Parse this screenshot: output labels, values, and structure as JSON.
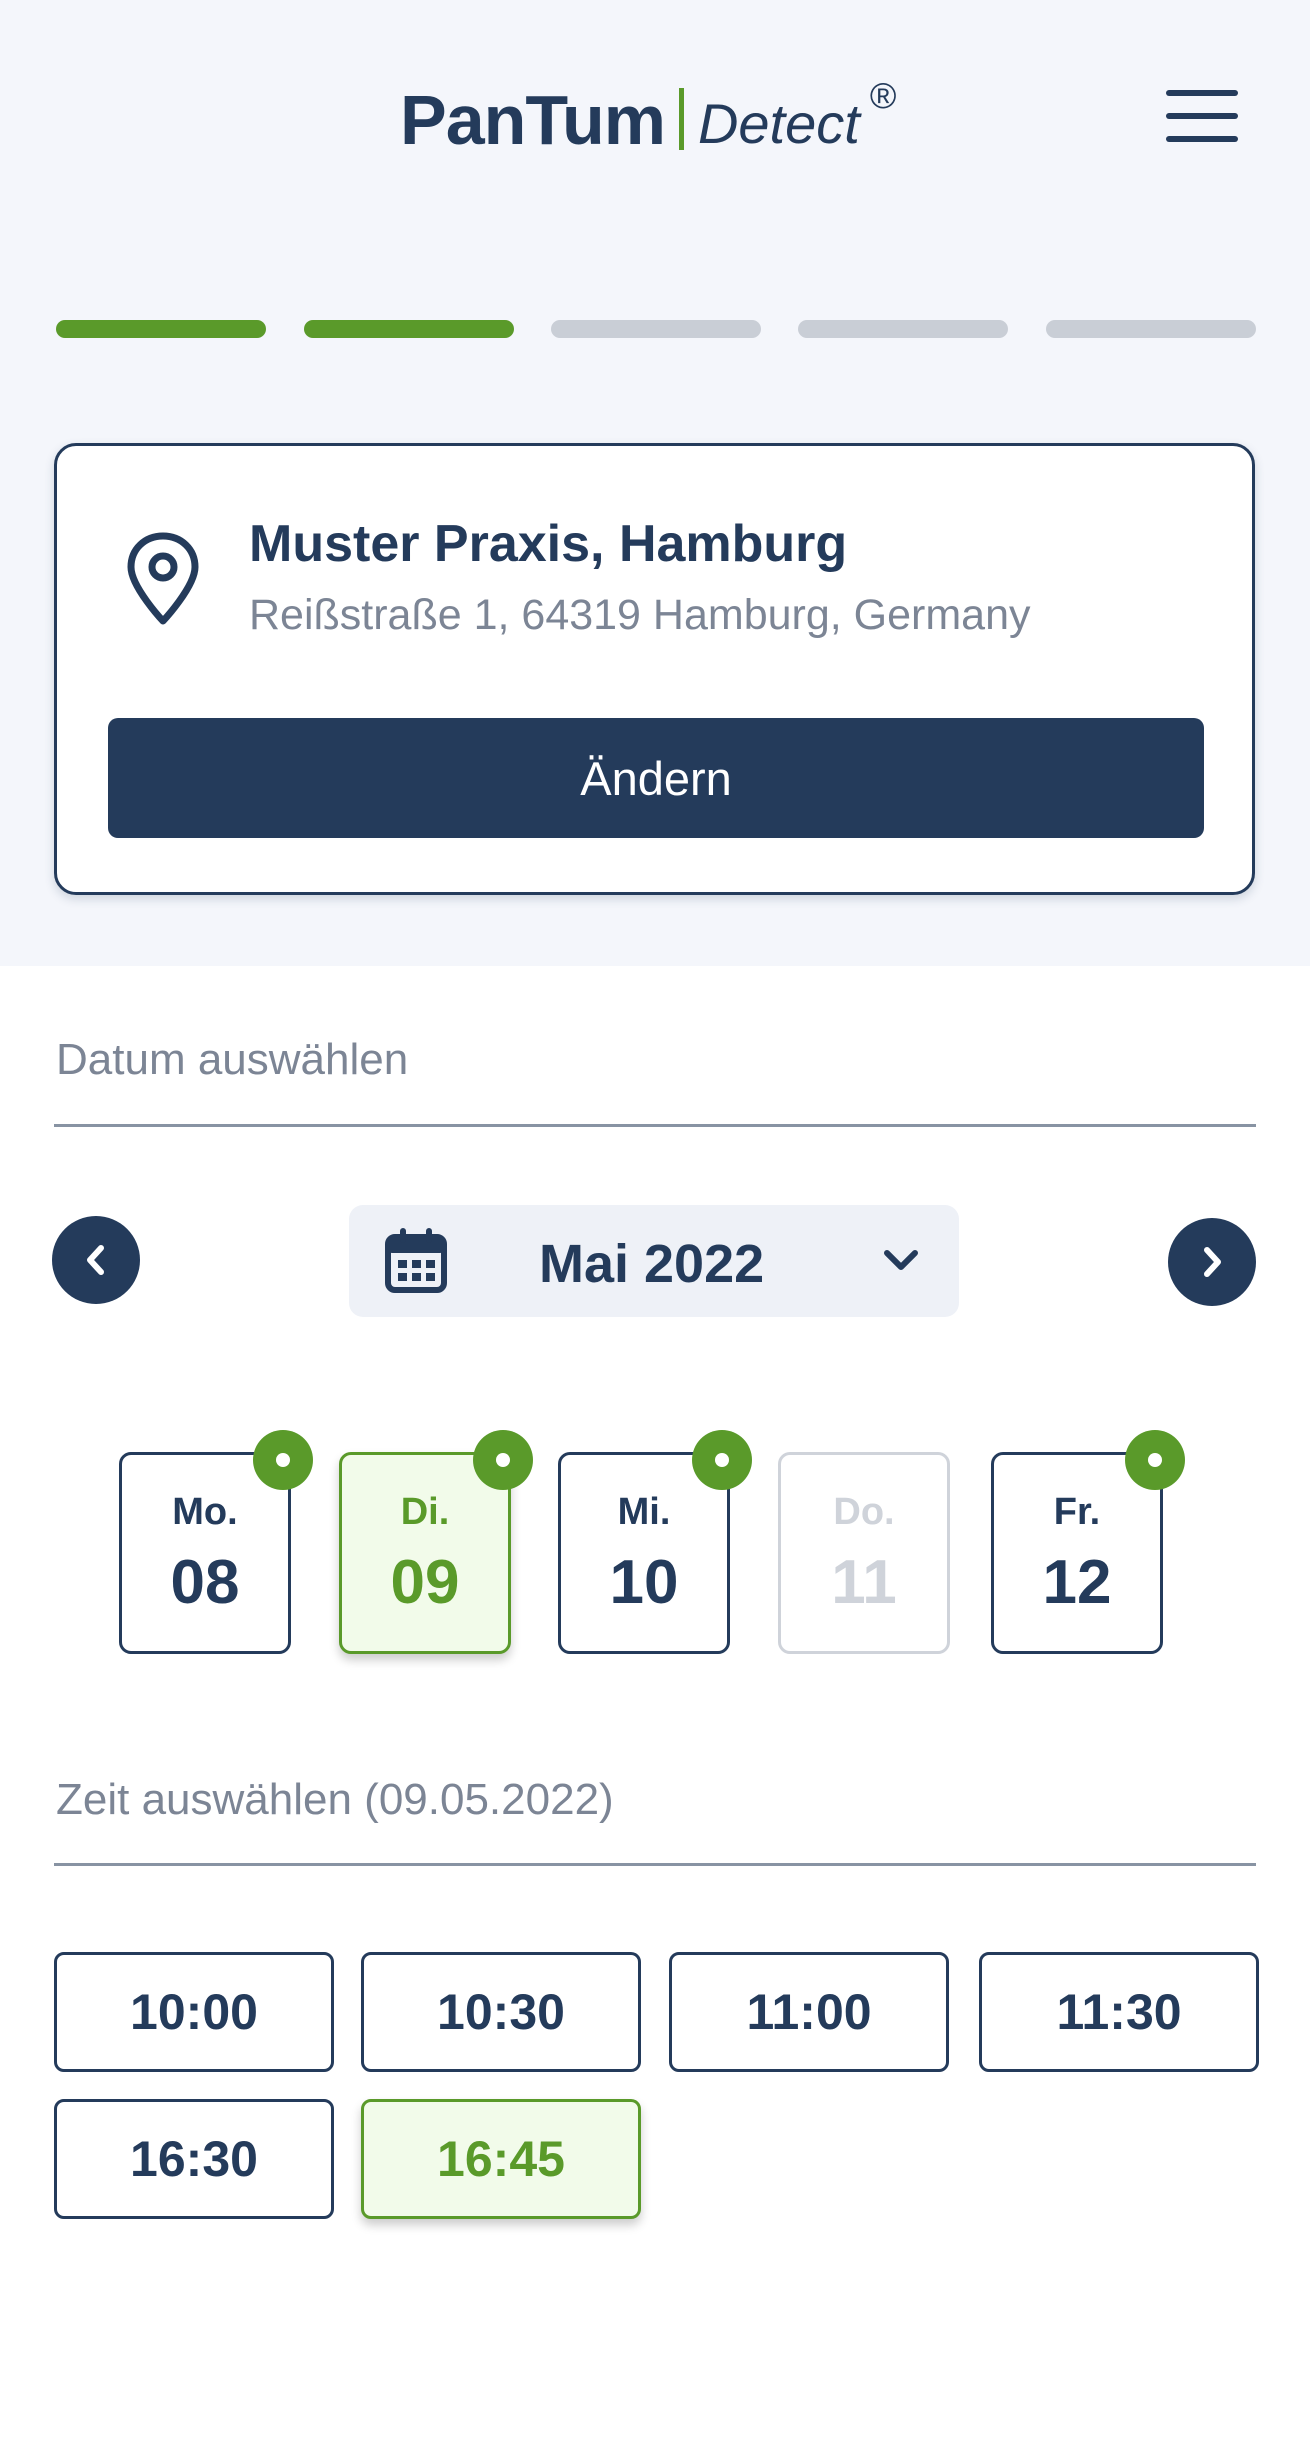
{
  "header": {
    "logo_main": "PanTum",
    "logo_sub": "Detect",
    "logo_reg": "®"
  },
  "progress": {
    "total_steps": 5,
    "completed_steps": 2
  },
  "location": {
    "name": "Muster Praxis, Hamburg",
    "address": "Reißstraße 1, 64319 Hamburg, Germany",
    "change_label": "Ändern"
  },
  "date_section": {
    "heading": "Datum auswählen",
    "month_label": "Mai 2022"
  },
  "days": [
    {
      "name": "Mo.",
      "num": "08",
      "state": "available"
    },
    {
      "name": "Di.",
      "num": "09",
      "state": "selected"
    },
    {
      "name": "Mi.",
      "num": "10",
      "state": "available"
    },
    {
      "name": "Do.",
      "num": "11",
      "state": "disabled"
    },
    {
      "name": "Fr.",
      "num": "12",
      "state": "available"
    }
  ],
  "time_section": {
    "heading": "Zeit auswählen (09.05.2022)"
  },
  "slots": [
    {
      "label": "10:00",
      "selected": false
    },
    {
      "label": "10:30",
      "selected": false
    },
    {
      "label": "11:00",
      "selected": false
    },
    {
      "label": "11:30",
      "selected": false
    },
    {
      "label": "16:30",
      "selected": false
    },
    {
      "label": "16:45",
      "selected": true
    }
  ],
  "colors": {
    "primary": "#243b5b",
    "accent_green": "#5a9a2a",
    "muted_text": "#7c8595",
    "page_bg": "#f4f6fb"
  },
  "icons": [
    "menu-icon",
    "location-pin-icon",
    "chevron-left-icon",
    "calendar-icon",
    "chevron-down-icon",
    "chevron-right-icon",
    "availability-dot-icon"
  ]
}
